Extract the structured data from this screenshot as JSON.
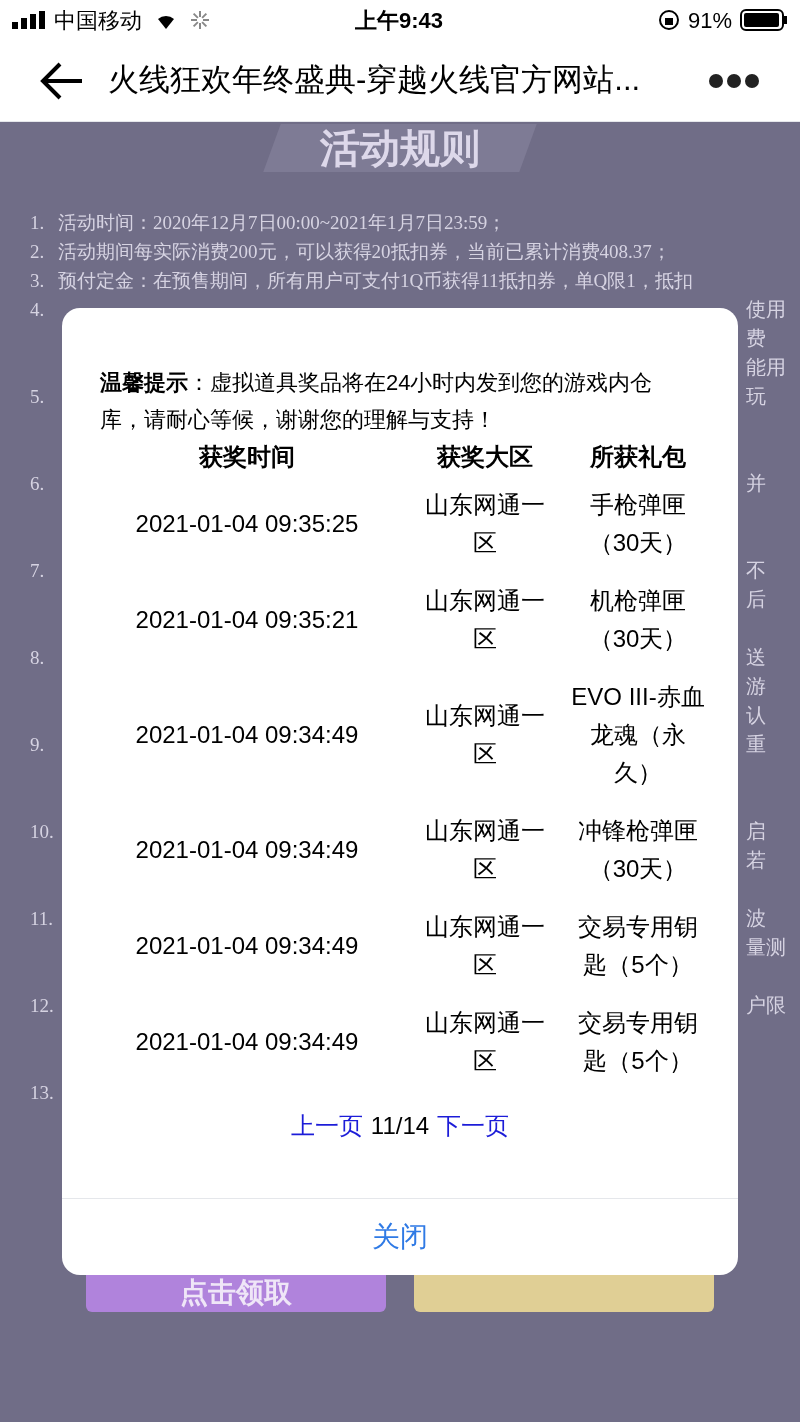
{
  "status_bar": {
    "carrier": "中国移动",
    "time": "上午9:43",
    "battery": "91%"
  },
  "nav": {
    "title": "火线狂欢年终盛典-穿越火线官方网站..."
  },
  "page": {
    "heading": "活动规则",
    "rules": [
      {
        "number": "1.",
        "text": "活动时间：2020年12月7日00:00~2021年1月7日23:59；"
      },
      {
        "number": "2.",
        "text": "活动期间每实际消费200元，可以获得20抵扣券，当前已累计消费408.37；"
      },
      {
        "number": "3.",
        "text": "预付定金：在预售期间，所有用户可支付1Q币获得11抵扣券，单Q限1，抵扣"
      },
      {
        "number": "4.",
        "fragments": [
          "使用",
          "费",
          "能用"
        ]
      },
      {
        "number": "5.",
        "fragments": [
          "玩"
        ]
      },
      {
        "number": "6.",
        "fragments": [
          "并"
        ]
      },
      {
        "number": "7.",
        "fragments": [
          "不",
          "后"
        ]
      },
      {
        "number": "8.",
        "fragments": [
          "送",
          "游",
          "认"
        ]
      },
      {
        "number": "9.",
        "fragments": [
          "重"
        ]
      },
      {
        "number": "10.",
        "fragments": [
          "启",
          "若"
        ]
      },
      {
        "number": "11.",
        "fragments": [
          "波",
          "量测"
        ]
      },
      {
        "number": "12.",
        "fragments": [
          "户限"
        ]
      },
      {
        "number": "13."
      }
    ],
    "buttons": [
      {
        "kind": "purple",
        "label": "点击领取"
      },
      {
        "kind": "gold"
      }
    ]
  },
  "dialog": {
    "notice": "**温馨提示**：虚拟道具奖品将在24小时内发到您的游戏内仓库，请耐心等候，谢谢您的理解与支持！",
    "table": {
      "columns": [
        "获奖时间",
        "获奖大区",
        "所获礼包"
      ],
      "rows": [
        [
          "2021-01-04 09:35:25",
          "山东网通一区",
          "手枪弹匣（30天）"
        ],
        [
          "2021-01-04 09:35:21",
          "山东网通一区",
          "机枪弹匣（30天）"
        ],
        [
          "2021-01-04 09:34:49",
          "山东网通一区",
          "EVO III-赤血龙魂（永久）"
        ],
        [
          "2021-01-04 09:34:49",
          "山东网通一区",
          "冲锋枪弹匣（30天）"
        ],
        [
          "2021-01-04 09:34:49",
          "山东网通一区",
          "交易专用钥匙（5个）"
        ],
        [
          "2021-01-04 09:34:49",
          "山东网通一区",
          "交易专用钥匙（5个）"
        ]
      ]
    },
    "pagination": {
      "prev": "上一页",
      "page": "11/14",
      "next": "下一页"
    },
    "close": "关闭"
  }
}
